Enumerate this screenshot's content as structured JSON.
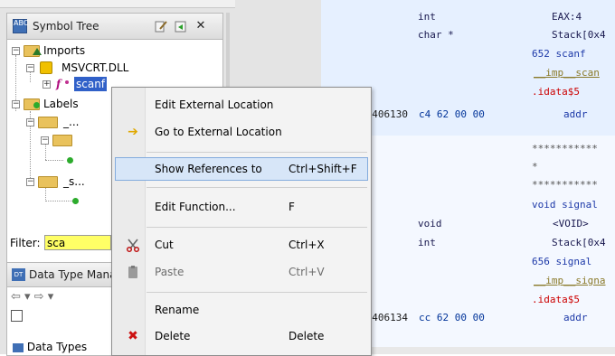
{
  "symbol_tree": {
    "title": "Symbol Tree",
    "logo_text": "ABC",
    "toolbar_icons": [
      "edit-icon",
      "export-icon",
      "close-icon"
    ],
    "close_glyph": "✕",
    "nodes": {
      "imports": "Imports",
      "msvcrt": "MSVCRT.DLL",
      "scanf": "scanf",
      "labels": "Labels",
      "label1": "_...",
      "label2": "_s..."
    },
    "filter": {
      "label": "Filter:",
      "value": "sca"
    }
  },
  "data_type_manager": {
    "title": "Data Type Mana",
    "logo_text": "DT",
    "nav_glyphs": "⇦ ▾ ⇨ ▾",
    "data_types_label": "Data Types"
  },
  "context_menu": {
    "items": [
      {
        "label": "Edit External Location",
        "shortcut": "",
        "icon": ""
      },
      {
        "label": "Go to External Location",
        "shortcut": "",
        "icon": "arrow-right-icon"
      },
      {
        "label": "Show References to",
        "shortcut": "Ctrl+Shift+F",
        "icon": ""
      },
      {
        "label": "Edit Function...",
        "shortcut": "F",
        "icon": ""
      },
      {
        "label": "Cut",
        "shortcut": "Ctrl+X",
        "icon": "scissors-icon"
      },
      {
        "label": "Paste",
        "shortcut": "Ctrl+V",
        "icon": "paste-icon"
      },
      {
        "label": "Rename",
        "shortcut": "",
        "icon": ""
      },
      {
        "label": "Delete",
        "shortcut": "Delete",
        "icon": "delete-x-icon"
      }
    ],
    "highlighted": "Show References to",
    "disabled": [
      "Paste"
    ],
    "colors": {
      "highlight": "#d7e6f8",
      "delete_icon": "#cc1111",
      "arrow_icon": "#e0a800"
    }
  },
  "listing": {
    "lines": {
      "l1_type": "int",
      "l1_val": "EAX:4",
      "l2_type": "char *",
      "l2_val": "Stack[0x4",
      "l3": "652  scanf",
      "l4": "__imp__scan",
      "l5": ".idata$5",
      "l6_addr": "00406130",
      "l6_bytes": "c4 62 00 00",
      "l6_ref": "addr",
      "l7": "***********",
      "l8": "*",
      "l9": "***********",
      "l10": "void signal",
      "l11_type": "void",
      "l11_val": "<VOID>",
      "l12_type": "int",
      "l12_val": "Stack[0x4",
      "l13": "656  signal",
      "l14": "__imp__signa",
      "l15": ".idata$5",
      "l16_addr": "00406134",
      "l16_bytes": "cc 62 00 00",
      "l16_ref": "addr"
    },
    "colors": {
      "top_bg": "#e6f0ff",
      "bottom_bg": "#f4f8ff"
    }
  }
}
